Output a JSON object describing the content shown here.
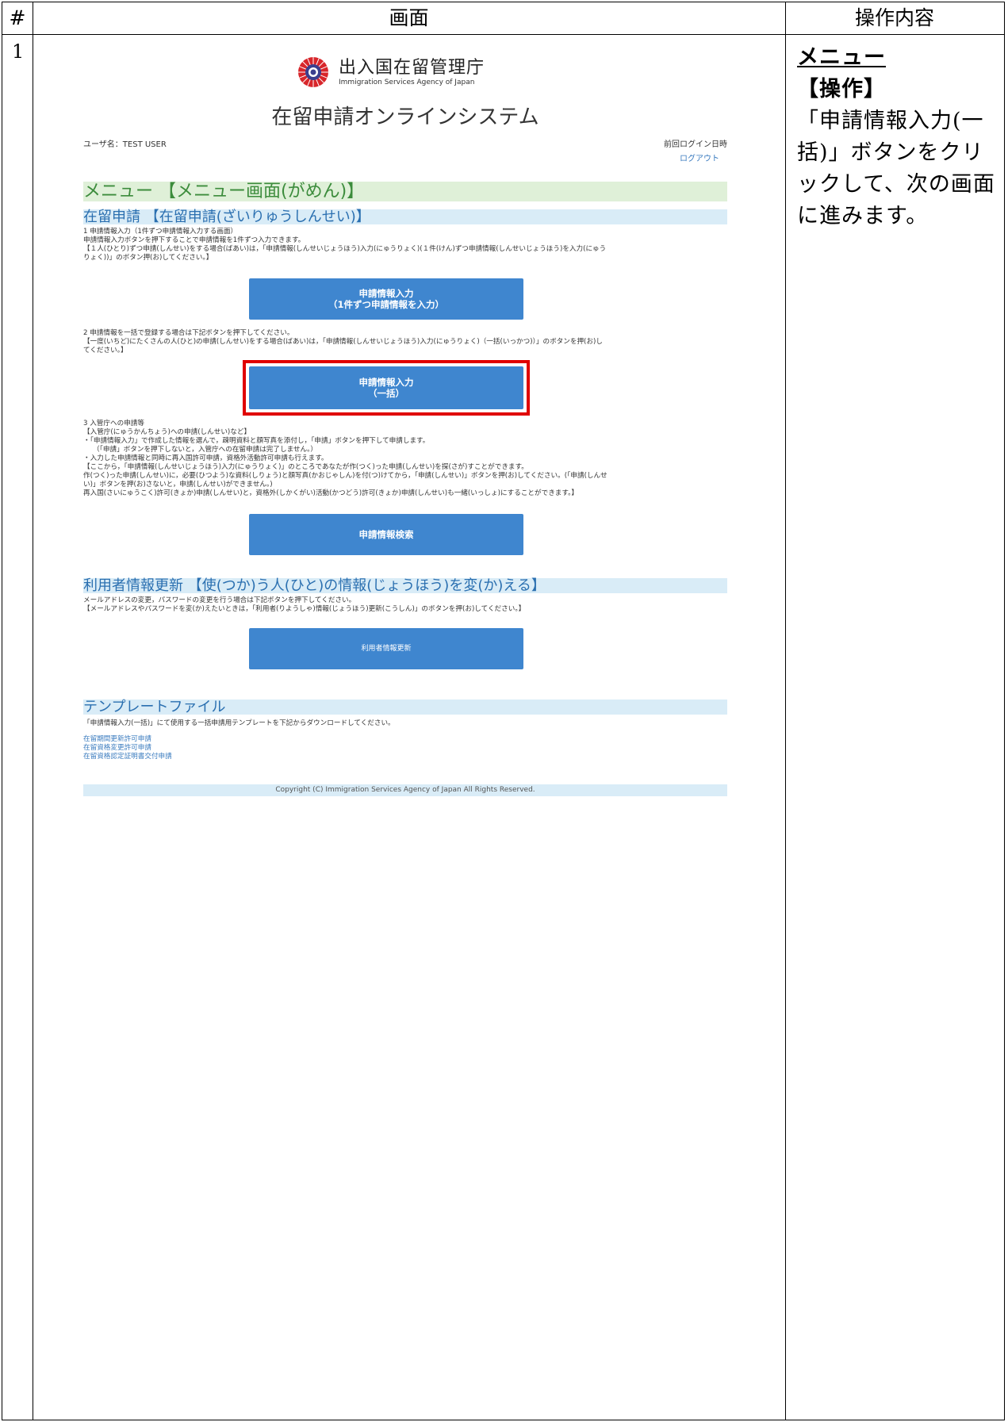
{
  "table": {
    "header_num": "#",
    "header_screen": "画面",
    "header_ops": "操作内容",
    "row_number": "1"
  },
  "ops": {
    "title": "メニュー",
    "label": "【操作】",
    "text": "「申請情報入力(一括)」ボタンをクリックして、次の画面に進みます。"
  },
  "screen": {
    "agency_name": "出入国在留管理庁",
    "agency_en": "Immigration Services Agency of Japan",
    "system_title": "在留申請オンラインシステム",
    "user_label": "ユーザ名：TEST USER",
    "last_login": "前回ログイン日時",
    "logout": "ログアウト",
    "menu_heading": "メニュー 【メニュー画面(がめん)】",
    "zairyu_heading": "在留申請 【在留申請(ざいりゅうしんせい)】",
    "s1_line1": "1 申請情報入力（1件ずつ申請情報入力する画面）",
    "s1_line2": "申請情報入力ボタンを押下することで申請情報を1件ずつ入力できます。",
    "s1_line3": "【１人(ひとり)ずつ申請(しんせい)をする場合(ばあい)は，「申請情報(しんせいじょうほう)入力(にゅうりょく)(１件(けん)ずつ申請情報(しんせいじょうほう)を入力(にゅう",
    "s1_line4": "りょく))」のボタン押(お)してください。】",
    "btn1_line1": "申請情報入力",
    "btn1_line2": "（1件ずつ申請情報を入力）",
    "s2_line1": "2 申請情報を一括で登録する場合は下記ボタンを押下してください。",
    "s2_line2": "【一度(いちど)にたくさんの人(ひと)の申請(しんせい)をする場合(ばあい)は，「申請情報(しんせいじょうほう)入力(にゅうりょく)（一括(いっかつ)）」のボタンを押(お)し",
    "s2_line3": "てください。】",
    "btn2_line1": "申請情報入力",
    "btn2_line2": "（一括）",
    "s3_lines": [
      "3 入管庁への申請等",
      "【入管庁(にゅうかんちょう)への申請(しんせい)など】",
      "・「申請情報入力」で作成した情報を選んで，疎明資料と顔写真を添付し，「申請」ボタンを押下して申請します。",
      "（「申請」ボタンを押下しないと，入管庁への在留申請は完了しません。）",
      "・入力した申請情報と同時に再入国許可申請，資格外活動許可申請も行えます。",
      "【ここから，「申請情報(しんせいじょうほう)入力(にゅうりょく)」のところであなたが作(つく)った申請(しんせい)を探(さが)すことができます。",
      "作(つく)った申請(しんせい)に，必要(ひつよう)な資料(しりょう)と顔写真(かおじゃしん)を付(つ)けてから，「申請(しんせい)」ボタンを押(お)してください。(「申請(しんせ",
      "い)」ボタンを押(お)さないと，申請(しんせい)ができません。)",
      "再入国(さいにゅうこく)許可(きょか)申請(しんせい)と，資格外(しかくがい)活動(かつどう)許可(きょか)申請(しんせい)も一緒(いっしょ)にすることができます。】"
    ],
    "btn3": "申請情報検索",
    "user_update_heading": "利用者情報更新 【使(つか)う人(ひと)の情報(じょうほう)を変(か)える】",
    "uu_line1": "メールアドレスの変更，パスワードの変更を行う場合は下記ボタンを押下してください。",
    "uu_line2": "【メールアドレスやパスワードを変(か)えたいときは，「利用者(りようしゃ)情報(じょうほう)更新(こうしん)」のボタンを押(お)してください。】",
    "btn4": "利用者情報更新",
    "template_heading": "テンプレートファイル",
    "template_text": "「申請情報入力(一括)」にて使用する一括申請用テンプレートを下記からダウンロードしてください。",
    "template_links": [
      "在留期間更新許可申請",
      "在留資格変更許可申請",
      "在留資格認定証明書交付申請"
    ],
    "copyright": "Copyright (C) Immigration Services Agency of Japan All Rights Reserved."
  },
  "colors": {
    "button": "#3f86cf",
    "highlight": "#e00000",
    "green_band": "#dff0d8",
    "blue_band": "#d9ecf7"
  }
}
